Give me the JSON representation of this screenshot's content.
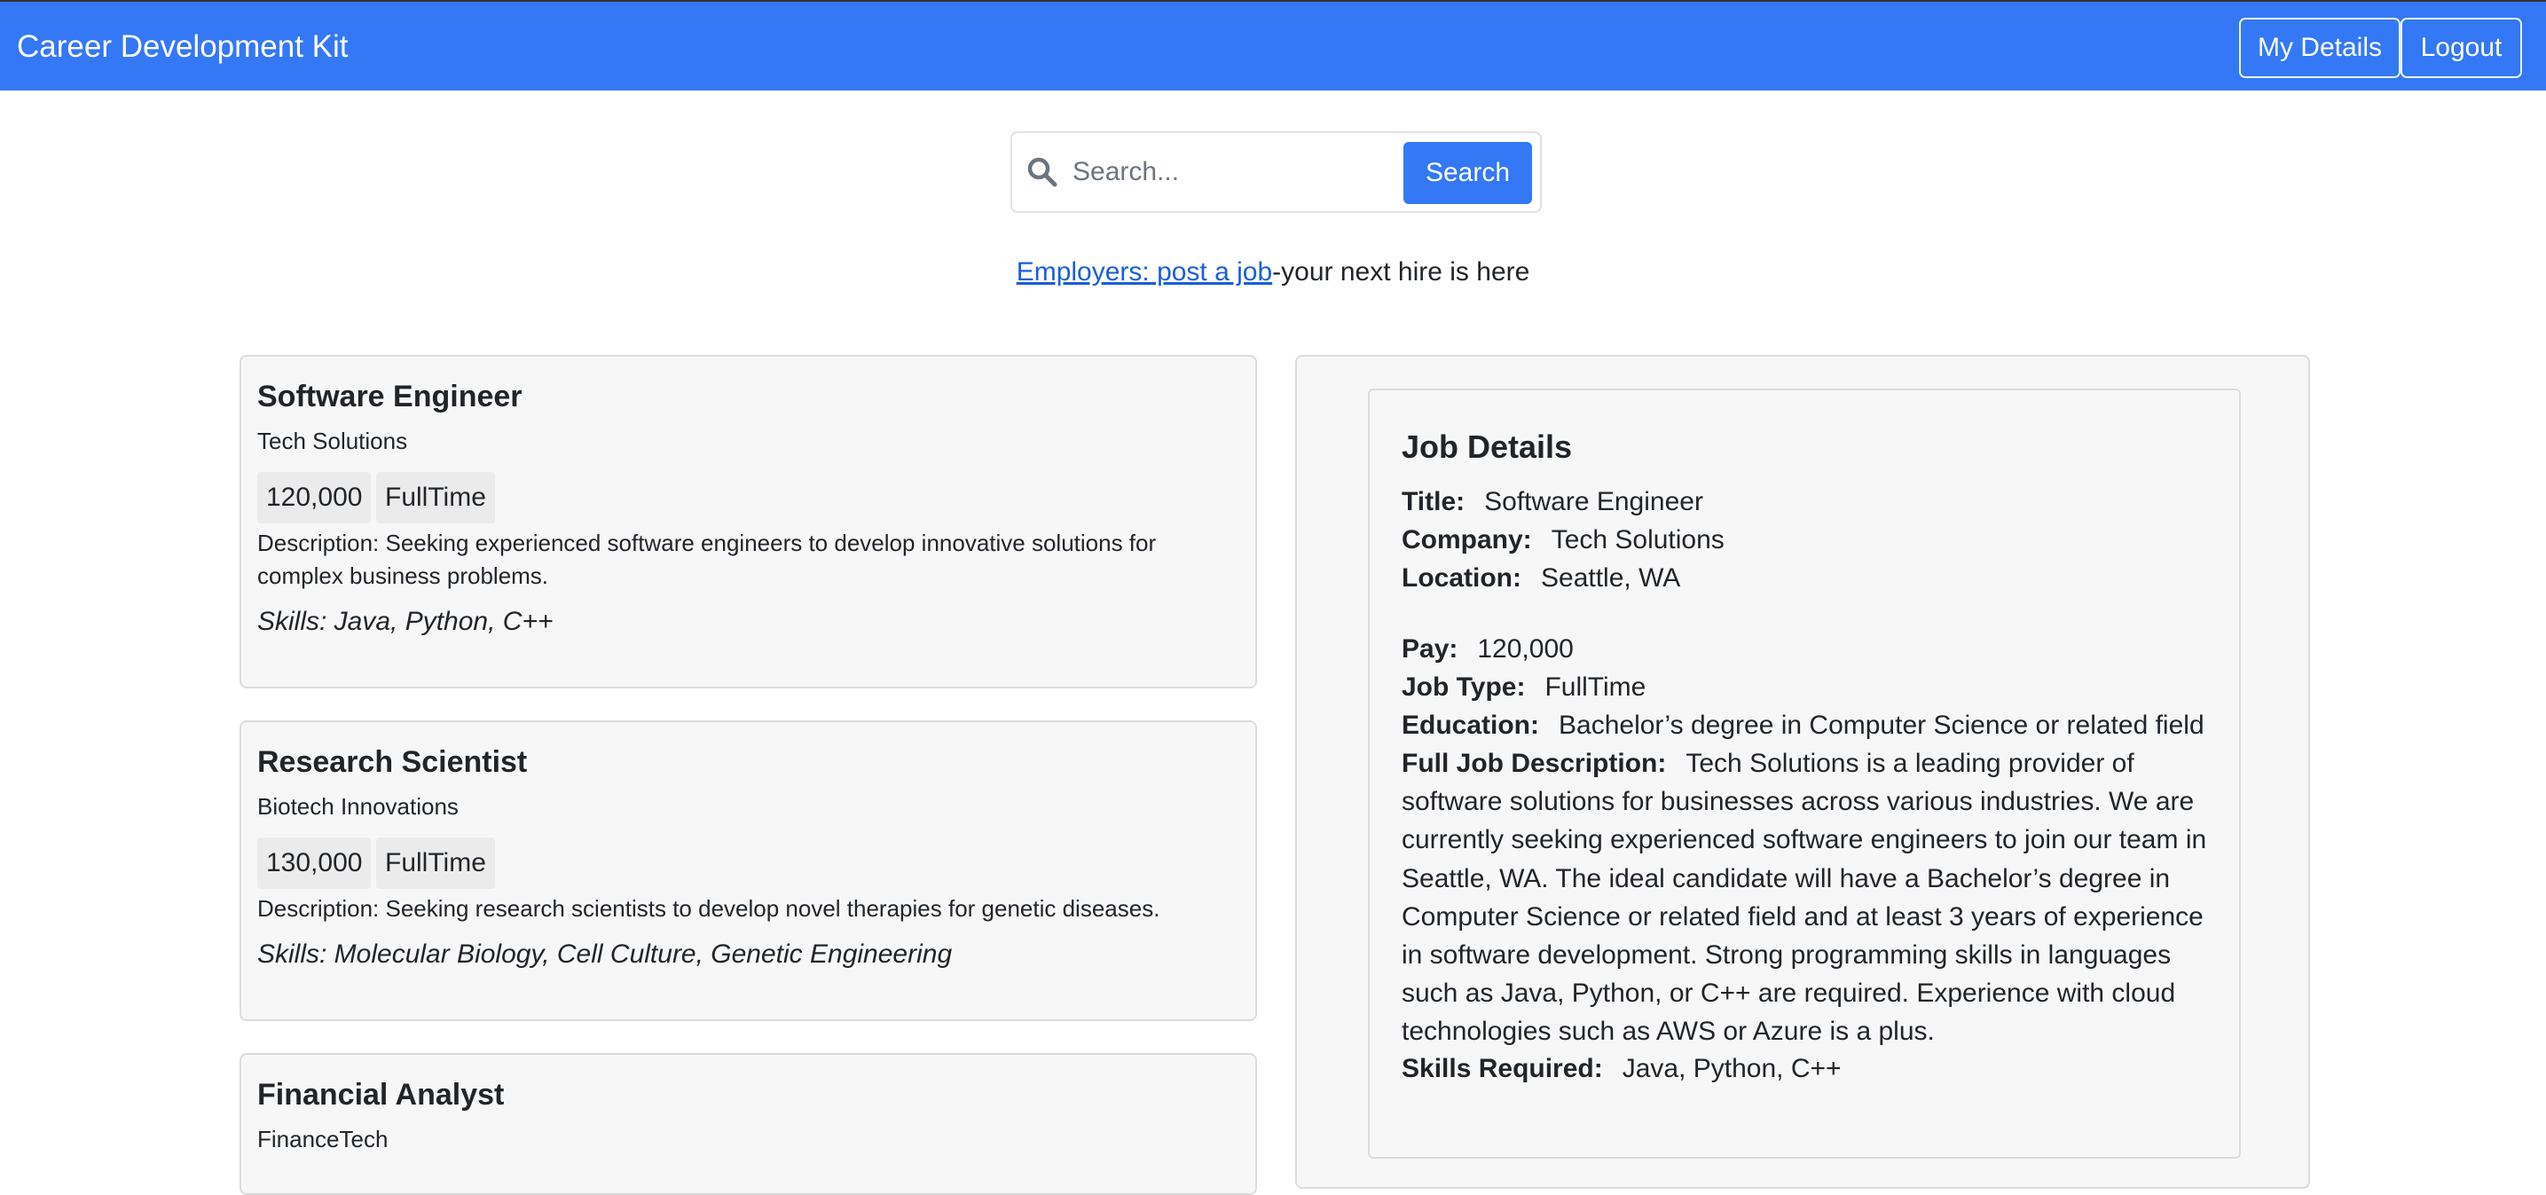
{
  "header": {
    "brand": "Career Development Kit",
    "my_details_label": "My Details",
    "logout_label": "Logout",
    "accent_color": "#3478f6"
  },
  "search": {
    "placeholder": "Search...",
    "value": "",
    "button_label": "Search",
    "icon": "search-icon"
  },
  "employer": {
    "link_text": "Employers: post a job",
    "suffix": "-your next hire is here"
  },
  "jobs": [
    {
      "title": "Software Engineer",
      "company": "Tech Solutions",
      "pay": "120,000",
      "type": "FullTime",
      "description": "Description: Seeking experienced software engineers to develop innovative solutions for complex business problems.",
      "skills": "Skills: Java, Python, C++"
    },
    {
      "title": "Research Scientist",
      "company": "Biotech Innovations",
      "pay": "130,000",
      "type": "FullTime",
      "description": "Description: Seeking research scientists to develop novel therapies for genetic diseases.",
      "skills": "Skills: Molecular Biology, Cell Culture, Genetic Engineering"
    },
    {
      "title": "Financial Analyst",
      "company": "FinanceTech"
    }
  ],
  "details": {
    "heading": "Job Details",
    "title_label": "Title:",
    "title_value": "Software Engineer",
    "company_label": "Company:",
    "company_value": "Tech Solutions",
    "location_label": "Location:",
    "location_value": "Seattle, WA",
    "pay_label": "Pay:",
    "pay_value": "120,000",
    "job_type_label": "Job Type:",
    "job_type_value": "FullTime",
    "education_label": "Education:",
    "education_value": "Bachelor’s degree in Computer Science or related field",
    "full_desc_label": "Full Job Description:",
    "full_desc_value": "Tech Solutions is a leading provider of software solutions for businesses across various industries. We are currently seeking experienced software engineers to join our team in Seattle, WA. The ideal candidate will have a Bachelor’s degree in Computer Science or related field and at least 3 years of experience in software development. Strong programming skills in languages such as Java, Python, or C++ are required. Experience with cloud technologies such as AWS or Azure is a plus.",
    "skills_label": "Skills Required:",
    "skills_value": "Java, Python, C++"
  }
}
